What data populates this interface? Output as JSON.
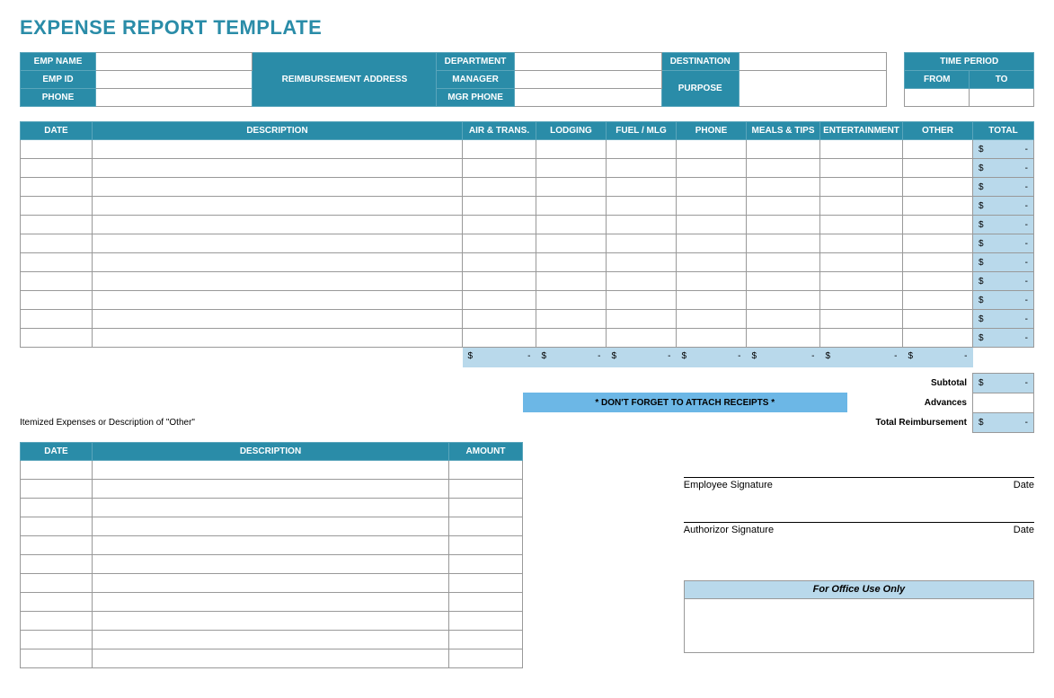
{
  "title": "EXPENSE REPORT TEMPLATE",
  "header": {
    "emp_name_label": "EMP NAME",
    "emp_id_label": "EMP ID",
    "phone_label": "PHONE",
    "reimb_addr_label": "REIMBURSEMENT ADDRESS",
    "department_label": "DEPARTMENT",
    "manager_label": "MANAGER",
    "mgr_phone_label": "MGR PHONE",
    "destination_label": "DESTINATION",
    "purpose_label": "PURPOSE",
    "time_period_label": "TIME PERIOD",
    "from_label": "FROM",
    "to_label": "TO",
    "emp_name": "",
    "emp_id": "",
    "phone": "",
    "reimb_addr": "",
    "department": "",
    "manager": "",
    "mgr_phone": "",
    "destination": "",
    "purpose": "",
    "from": "",
    "to": ""
  },
  "expense_cols": {
    "date": "DATE",
    "description": "DESCRIPTION",
    "air": "AIR & TRANS.",
    "lodging": "LODGING",
    "fuel": "FUEL / MLG",
    "phone": "PHONE",
    "meals": "MEALS & TIPS",
    "ent": "ENTERTAINMENT",
    "other": "OTHER",
    "total": "TOTAL"
  },
  "row_total": {
    "sym": "$",
    "dash": "-"
  },
  "col_sum": {
    "sym": "$",
    "dash": "-"
  },
  "summary": {
    "subtotal_label": "Subtotal",
    "advances_label": "Advances",
    "total_reimb_label": "Total Reimbursement",
    "subtotal_sym": "$",
    "subtotal_val": "-",
    "advances_val": "",
    "total_reimb_sym": "$",
    "total_reimb_val": "-"
  },
  "reminder": "* DON'T FORGET TO ATTACH RECEIPTS *",
  "itemized": {
    "caption": "Itemized Expenses or Description of \"Other\"",
    "date": "DATE",
    "description": "DESCRIPTION",
    "amount": "AMOUNT"
  },
  "sig": {
    "emp_label": "Employee Signature",
    "auth_label": "Authorizor Signature",
    "date_label": "Date"
  },
  "office_label": "For Office Use Only"
}
